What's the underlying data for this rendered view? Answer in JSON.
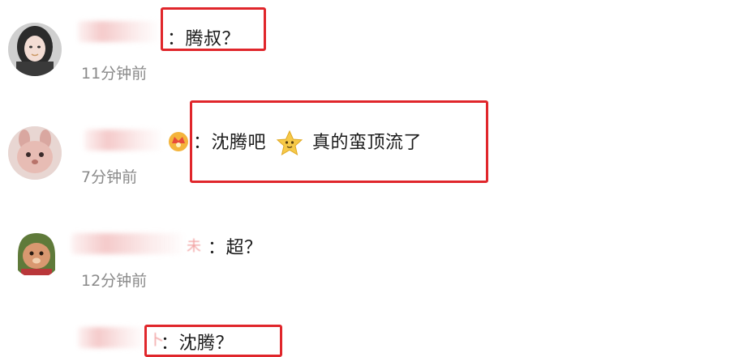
{
  "comments": [
    {
      "text": "：腾叔？",
      "time": "11分钟前",
      "name_tail": ""
    },
    {
      "text_a": "：沈腾吧",
      "text_b": "真的蛮顶流了",
      "time": "7分钟前",
      "emoji": "star-face-emoji",
      "badge": "crown-badge"
    },
    {
      "text": "：超？",
      "time": "12分钟前",
      "name_tail": "未"
    },
    {
      "text": "：沈腾？",
      "name_tail": "卜"
    }
  ],
  "colors": {
    "highlight": "#e0262b",
    "time": "#8a8a8a"
  }
}
